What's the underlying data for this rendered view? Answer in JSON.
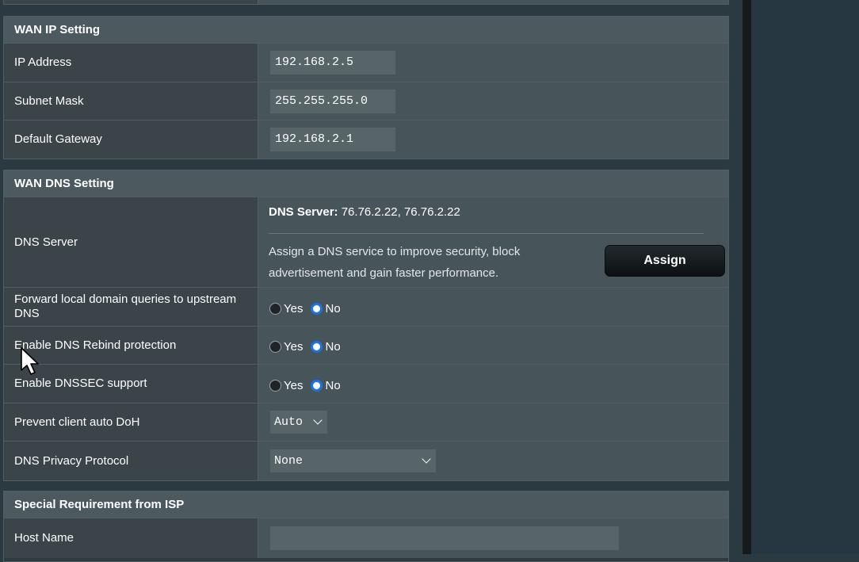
{
  "wan_ip": {
    "title": "WAN IP Setting",
    "ip_address_label": "IP Address",
    "ip_address_value": "192.168.2.5",
    "subnet_label": "Subnet Mask",
    "subnet_value": "255.255.255.0",
    "gateway_label": "Default Gateway",
    "gateway_value": "192.168.2.1"
  },
  "wan_dns": {
    "title": "WAN DNS Setting",
    "dns_server_label": "DNS Server",
    "dns_server_prefix": "DNS Server:",
    "dns_server_value": "76.76.2.22, 76.76.2.22",
    "dns_desc": "Assign a DNS service to improve security, block advertisement and gain faster performance.",
    "assign_label": "Assign",
    "forward_label": "Forward local domain queries to upstream DNS",
    "rebind_label": "Enable DNS Rebind protection",
    "dnssec_label": "Enable DNSSEC support",
    "yes_label": "Yes",
    "no_label": "No",
    "doh_label": "Prevent client auto DoH",
    "doh_value": "Auto",
    "privacy_label": "DNS Privacy Protocol",
    "privacy_value": "None"
  },
  "isp": {
    "title": "Special Requirement from ISP",
    "host_name_label": "Host Name",
    "host_name_value": ""
  },
  "colors": {
    "radio_selected": "#1a73e8",
    "header_bg": "#4c5a60"
  }
}
